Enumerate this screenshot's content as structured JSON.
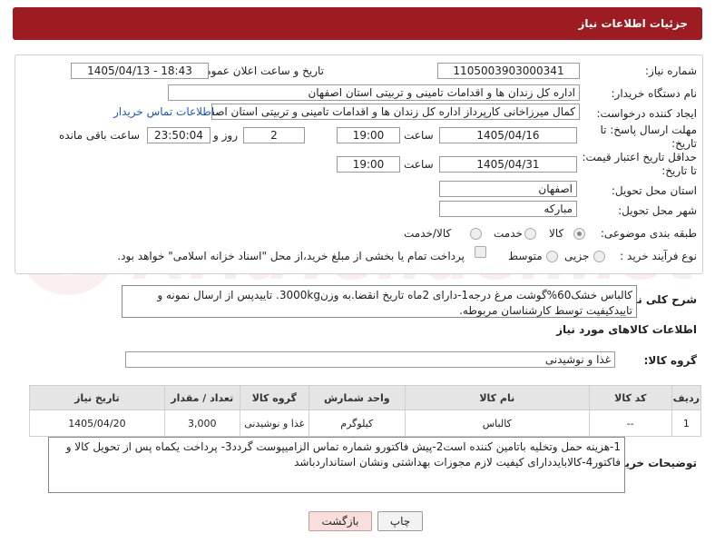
{
  "header": {
    "title": "جزئیات اطلاعات نیاز"
  },
  "form": {
    "need_number_label": "شماره نیاز:",
    "need_number": "1105003903000341",
    "announce_label": "تاریخ و ساعت اعلان عمومی:",
    "announce_value": "1405/04/13 - 18:43",
    "buyer_org_label": "نام دستگاه خریدار:",
    "buyer_org": "اداره کل زندان ها و اقدامات تامینی و تربیتی استان اصفهان",
    "requester_label": "ایجاد کننده درخواست:",
    "requester": "کمال میرزاخانی کارپرداز اداره کل زندان ها و اقدامات تامینی و تربیتی استان اصفه",
    "contact_link": "اطلاعات تماس خریدار",
    "reply_deadline_label": "مهلت ارسال پاسخ: تا تاریخ:",
    "reply_date": "1405/04/16",
    "time_label": "ساعت",
    "reply_time": "19:00",
    "days_value": "2",
    "days_label": "روز و",
    "remaining_time": "23:50:04",
    "remaining_label": "ساعت باقی مانده",
    "price_validity_label": "حداقل تاریخ اعتبار قیمت: تا تاریخ:",
    "price_date": "1405/04/31",
    "price_time": "19:00",
    "province_label": "استان محل تحویل:",
    "province": "اصفهان",
    "city_label": "شهر محل تحویل:",
    "city": "مبارکه",
    "category_label": "طبقه بندی موضوعی:",
    "category_options": [
      "کالا",
      "خدمت",
      "کالا/خدمت"
    ],
    "process_label": "نوع فرآیند خرید :",
    "process_options": [
      "جزیی",
      "متوسط"
    ],
    "payment_note": "پرداخت تمام یا بخشی از مبلغ خرید،از محل \"اسناد خزانه اسلامی\" خواهد بود."
  },
  "description": {
    "label": "شرح کلی نیاز:",
    "text": "کالباس خشک60%گوشت مرغ درجه1-دارای 2ماه تاریخ انقضا.به وزن3000kg. تاییدپس از ارسال نمونه و تاییدکیفیت توسط کارشناسان مربوطه."
  },
  "goods": {
    "section_title": "اطلاعات کالاهای مورد نیاز",
    "group_label": "گروه کالا:",
    "group_value": "غذا و نوشیدنی",
    "columns": [
      "ردیف",
      "کد کالا",
      "نام کالا",
      "واحد شمارش",
      "گروه کالا",
      "تعداد / مقدار",
      "تاریخ نیاز"
    ],
    "rows": [
      [
        "1",
        "--",
        "کالباس",
        "کیلوگرم",
        "غذا و نوشیدنی",
        "3,000",
        "1405/04/20"
      ]
    ]
  },
  "buyer_notes": {
    "label": "توضیحات خریدار:",
    "text": "1-هزینه حمل وتخلیه باتامین کننده است2-پیش فاکتورو شماره تماس الزامیپوست گردد3- پرداخت یکماه پس از تحویل کالا و فاکتور4-کالابایددارای کیفیت لازم مجوزات بهداشتی ونشان استانداردباشد"
  },
  "buttons": {
    "print": "چاپ",
    "back": "بازگشت"
  },
  "watermark": "AriaTender.net",
  "colors": {
    "header_bg": "#9c1c22",
    "link": "#1a56c4",
    "back_button_bg": "#f9dede"
  }
}
